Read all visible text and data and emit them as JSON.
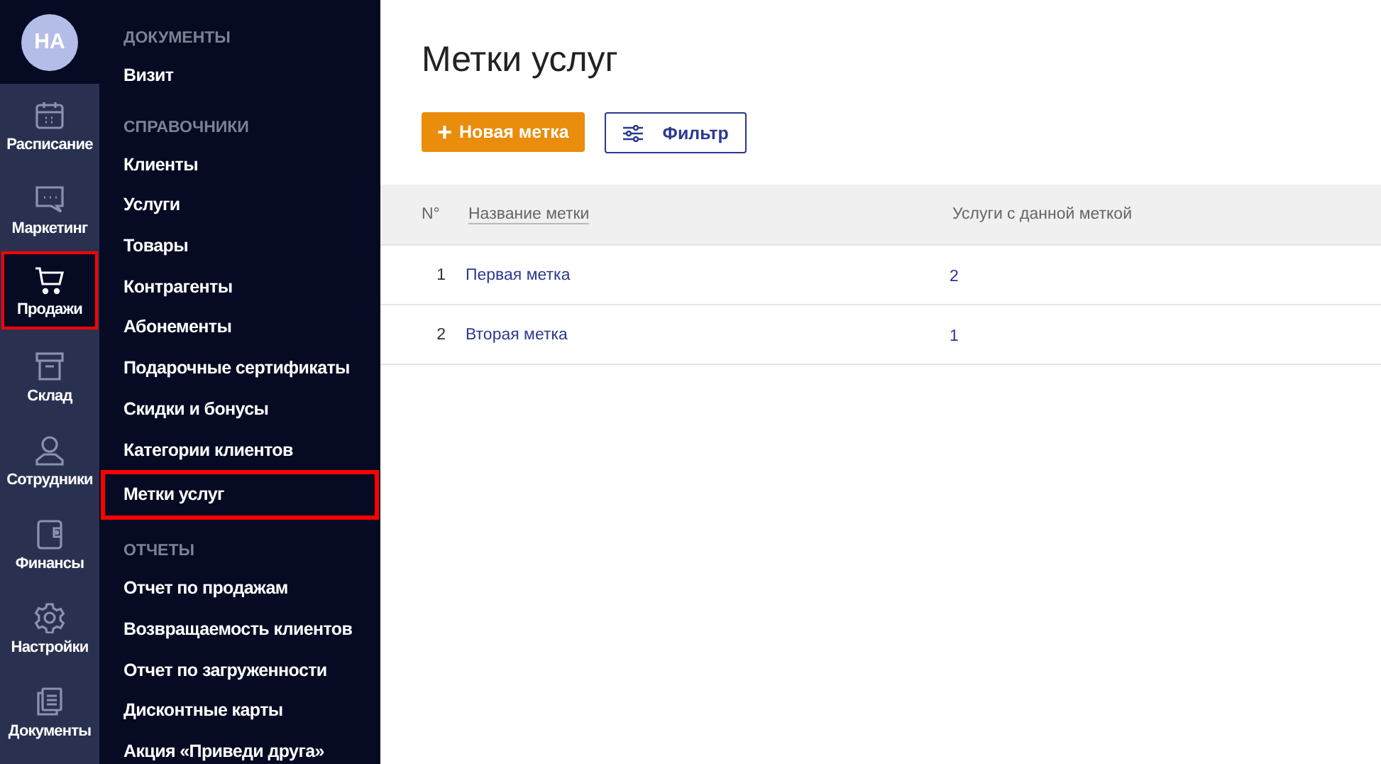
{
  "user": {
    "initials": "НА"
  },
  "rail": [
    {
      "kind": "calendar",
      "label": "Расписание",
      "selected": false
    },
    {
      "kind": "chat",
      "label": "Маркетинг",
      "selected": false
    },
    {
      "kind": "cart",
      "label": "Продажи",
      "selected": true
    },
    {
      "kind": "box",
      "label": "Склад",
      "selected": false
    },
    {
      "kind": "person",
      "label": "Сотрудники",
      "selected": false
    },
    {
      "kind": "wallet",
      "label": "Финансы",
      "selected": false
    },
    {
      "kind": "gear",
      "label": "Настройки",
      "selected": false
    },
    {
      "kind": "docs",
      "label": "Документы",
      "selected": false
    }
  ],
  "submenu": [
    {
      "heading": "ДОКУМЕНТЫ",
      "items": [
        {
          "label": "Визит",
          "selected": false
        }
      ]
    },
    {
      "heading": "СПРАВОЧНИКИ",
      "items": [
        {
          "label": "Клиенты",
          "selected": false
        },
        {
          "label": "Услуги",
          "selected": false
        },
        {
          "label": "Товары",
          "selected": false
        },
        {
          "label": "Контрагенты",
          "selected": false
        },
        {
          "label": "Абонементы",
          "selected": false
        },
        {
          "label": "Подарочные сертификаты",
          "selected": false
        },
        {
          "label": "Скидки и бонусы",
          "selected": false
        },
        {
          "label": "Категории клиентов",
          "selected": false
        },
        {
          "label": "Метки услуг",
          "selected": true
        }
      ]
    },
    {
      "heading": "ОТЧЕТЫ",
      "items": [
        {
          "label": "Отчет по продажам",
          "selected": false
        },
        {
          "label": "Возвращаемость клиентов",
          "selected": false
        },
        {
          "label": "Отчет по загруженности",
          "selected": false
        },
        {
          "label": "Дисконтные карты",
          "selected": false
        },
        {
          "label": "Акция «Приведи друга»",
          "selected": false
        }
      ]
    }
  ],
  "page": {
    "title": "Метки услуг",
    "new_button": {
      "icon": "+",
      "label": "Новая метка"
    },
    "filter_button": {
      "label": "Фильтр"
    }
  },
  "table": {
    "columns": [
      "N°",
      "Название метки",
      "Услуги с данной меткой"
    ],
    "rows": [
      {
        "number": "1",
        "name": "Первая метка",
        "count": "2"
      },
      {
        "number": "2",
        "name": "Вторая метка",
        "count": "1"
      }
    ]
  }
}
